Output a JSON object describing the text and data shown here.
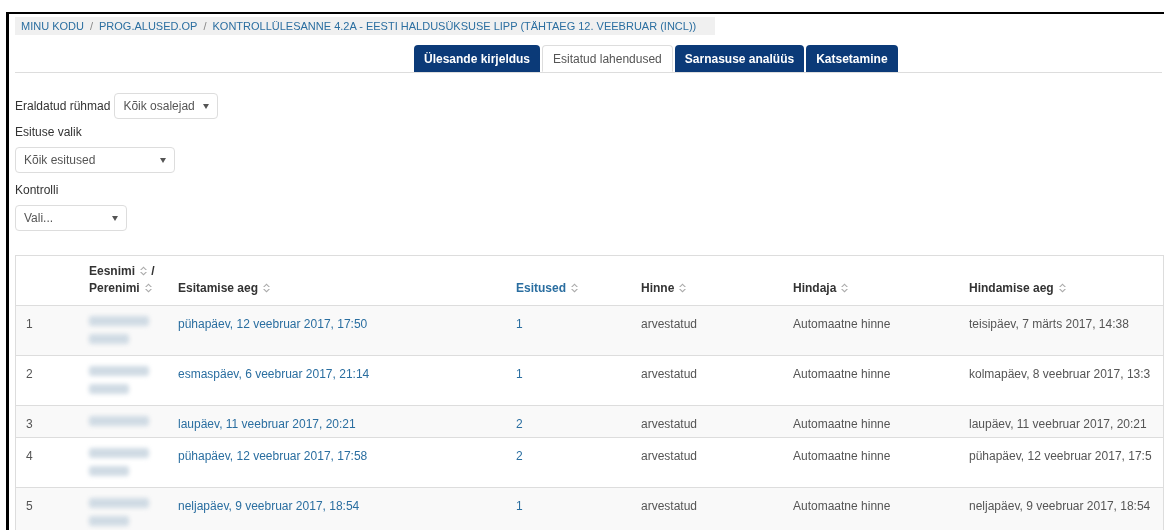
{
  "breadcrumb": [
    "MINU KODU",
    "PROG.ALUSED.OP",
    "KONTROLLÜLESANNE 4.2A - EESTI HALDUSÜKSUSE LIPP (TÄHTAEG 12. VEEBRUAR (INCL))"
  ],
  "breadcrumb_separator": "/",
  "tabs": [
    {
      "label": "Ülesande kirjeldus",
      "selected": false
    },
    {
      "label": "Esitatud lahendused",
      "selected": true
    },
    {
      "label": "Sarnasuse analüüs",
      "selected": false
    },
    {
      "label": "Katsetamine",
      "selected": false
    }
  ],
  "filters": {
    "groups": {
      "label": "Eraldatud rühmad",
      "value": "Kõik osalejad"
    },
    "submission": {
      "label": "Esituse valik",
      "value": "Kõik esitused"
    },
    "check": {
      "label": "Kontrolli",
      "value": "Vali..."
    }
  },
  "table": {
    "columns": [
      {
        "lines": [
          "Eesnimi",
          "Perenimi"
        ],
        "joiner": "/",
        "sorted": false
      },
      {
        "lines": [
          "Esitamise aeg"
        ],
        "sorted": false
      },
      {
        "lines": [
          "Esitused"
        ],
        "sorted": true
      },
      {
        "lines": [
          "Hinne"
        ],
        "sorted": false
      },
      {
        "lines": [
          "Hindaja"
        ],
        "sorted": false
      },
      {
        "lines": [
          "Hindamise aeg"
        ],
        "sorted": false
      }
    ],
    "rows": [
      {
        "index": "1",
        "kind": "tall",
        "submitted": "pühapäev, 12 veebruar 2017, 17:50",
        "submissions": "1",
        "grade": "arvestatud",
        "grader": "Automaatne hinne",
        "graded": "teisipäev, 7 märts 2017, 14:38"
      },
      {
        "index": "2",
        "kind": "tall",
        "submitted": "esmaspäev, 6 veebruar 2017, 21:14",
        "submissions": "1",
        "grade": "arvestatud",
        "grader": "Automaatne hinne",
        "graded": "kolmapäev, 8 veebruar 2017, 13:3"
      },
      {
        "index": "3",
        "kind": "short",
        "submitted": "laupäev, 11 veebruar 2017, 20:21",
        "submissions": "2",
        "grade": "arvestatud",
        "grader": "Automaatne hinne",
        "graded": "laupäev, 11 veebruar 2017, 20:21"
      },
      {
        "index": "4",
        "kind": "tall",
        "submitted": "pühapäev, 12 veebruar 2017, 17:58",
        "submissions": "2",
        "grade": "arvestatud",
        "grader": "Automaatne hinne",
        "graded": "pühapäev, 12 veebruar 2017, 17:5"
      },
      {
        "index": "5",
        "kind": "tall",
        "submitted": "neljapäev, 9 veebruar 2017, 18:54",
        "submissions": "1",
        "grade": "arvestatud",
        "grader": "Automaatne hinne",
        "graded": "neljapäev, 9 veebruar 2017, 18:54"
      }
    ]
  }
}
